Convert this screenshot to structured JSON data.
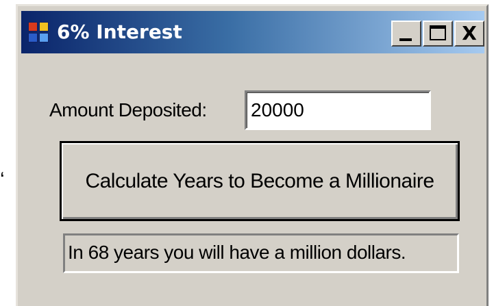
{
  "window": {
    "title": "6% Interest",
    "minimize_glyph": "_",
    "maximize_glyph": "□",
    "close_glyph": "X",
    "icon": "app-window-icon"
  },
  "form": {
    "amount_label": "Amount Deposited:",
    "amount_value": "20000",
    "calculate_label": "Calculate Years to Become a Millionaire",
    "result_text": "In 68 years you will have a million dollars."
  },
  "colors": {
    "titlebar_start": "#0a246a",
    "titlebar_end": "#a6caf0",
    "window_bg": "#d4d0c8"
  }
}
